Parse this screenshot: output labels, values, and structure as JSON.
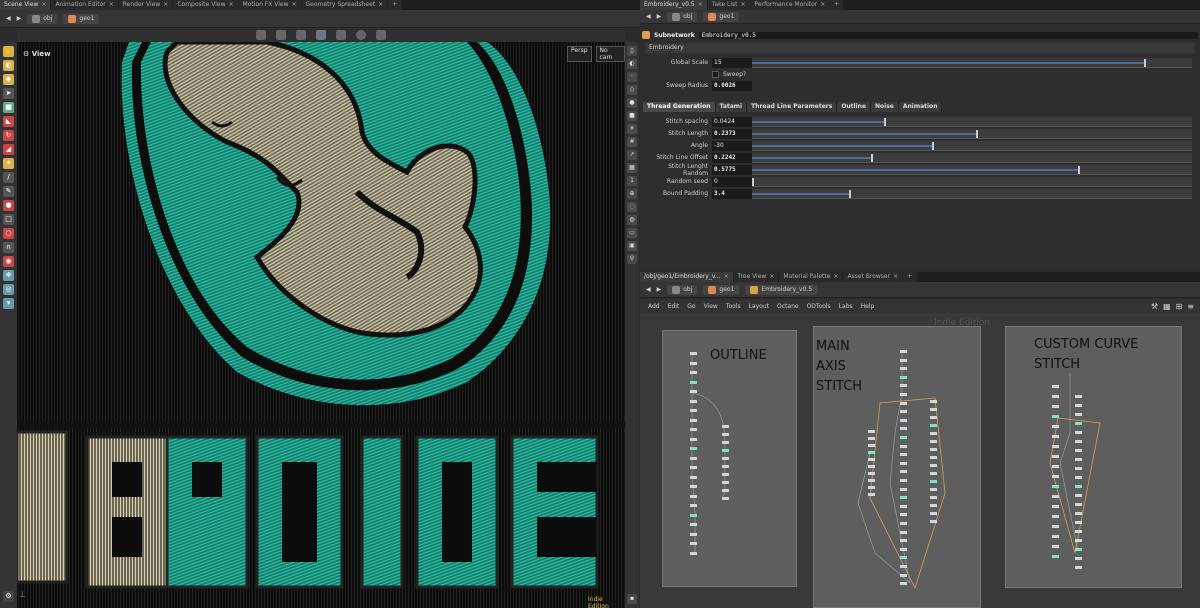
{
  "left_tabs": [
    "Scene View",
    "Animation Editor",
    "Render View",
    "Composite View",
    "Motion FX View",
    "Geometry Spreadsheet"
  ],
  "right_tabs": [
    "Embroidery_v0.5",
    "Take List",
    "Performance Monitor"
  ],
  "path": {
    "root": "obj",
    "node": "geo1"
  },
  "viewport": {
    "label": "View",
    "persp": "Persp",
    "cam": "No cam",
    "edition": "Indie Edition",
    "text": "BROIDE"
  },
  "parm": {
    "type": "Subnetwork",
    "name": "Embroidery_v0.5",
    "folder": "Embroidery",
    "global_scale_label": "Global Scale",
    "global_scale": "15",
    "sweep_label": "Sweep?",
    "sweep_radius_label": "Sweep Radius",
    "sweep_radius": "0.0026",
    "tabs": [
      "Thread Generation",
      "Tatami",
      "Thread Line Parameters",
      "Outline",
      "Noise",
      "Animation"
    ],
    "rows": [
      {
        "label": "Stitch spacing",
        "value": "0.0424",
        "fill": 0.3
      },
      {
        "label": "Stitch Length",
        "value": "0.2373",
        "fill": 0.51
      },
      {
        "label": "Angle",
        "value": "-30",
        "fill": 0.41
      },
      {
        "label": "Stitch Line Offset",
        "value": "0.2242",
        "fill": 0.27
      },
      {
        "label": "Stitch Lenght Random",
        "value": "0.5775",
        "fill": 0.74
      },
      {
        "label": "Random seed",
        "value": "0",
        "fill": 0.0
      },
      {
        "label": "Bound Padding",
        "value": "3.4",
        "fill": 0.22
      }
    ]
  },
  "net_tabs": [
    "/obj/geo1/Embroidery_v...",
    "Tree View",
    "Material Palette",
    "Asset Browser"
  ],
  "net_path": {
    "root": "obj",
    "node": "geo1",
    "sub": "Embroidery_v0.5"
  },
  "menu": [
    "Add",
    "Edit",
    "Go",
    "View",
    "Tools",
    "Layout",
    "Octane",
    "ODTools",
    "Labs",
    "Help"
  ],
  "net_watermark": "Indie Edition",
  "boxes": [
    {
      "title": "OUTLINE"
    },
    {
      "title": "MAIN\nAXIS\nSTITCH"
    },
    {
      "title": "CUSTOM CURVE\nSTITCH"
    }
  ],
  "colors": {
    "teal": "#1f9e86",
    "thread": "#c9c1a0",
    "accent": "#d9a24b"
  }
}
